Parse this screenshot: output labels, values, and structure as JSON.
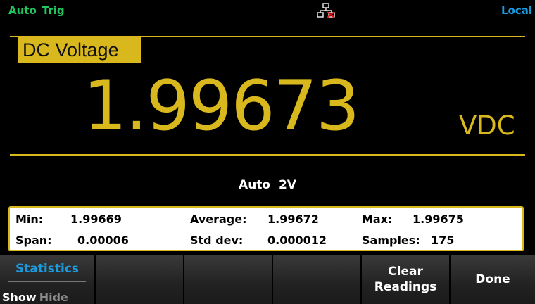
{
  "status": {
    "trigger_mode": "Auto",
    "trigger_label": "Trig",
    "remote_state": "Local",
    "network_icon": "lan-disconnected-icon"
  },
  "measurement": {
    "function": "DC Voltage",
    "reading": "1.99673",
    "unit": "VDC",
    "range": "Auto  2V"
  },
  "statistics": {
    "min_label": "Min:",
    "min_value": "1.99669",
    "average_label": "Average:",
    "average_value": "1.99672",
    "max_label": "Max:",
    "max_value": "1.99675",
    "span_label": "Span:",
    "span_value": "0.00006",
    "stddev_label": "Std dev:",
    "stddev_value": "0.000012",
    "samples_label": "Samples:",
    "samples_value": "175"
  },
  "softkeys": {
    "statistics_title": "Statistics",
    "show_option": "Show",
    "hide_option": "Hide",
    "selected_option": "Show",
    "key2": "",
    "key3": "",
    "key4": "",
    "clear_line1": "Clear",
    "clear_line2": "Readings",
    "done": "Done"
  },
  "colors": {
    "accent_yellow": "#d9b81e",
    "status_green": "#22c55e",
    "status_blue": "#1a9be0",
    "text_white": "#ffffff",
    "text_dim": "#8a8a8a",
    "background": "#000000"
  }
}
